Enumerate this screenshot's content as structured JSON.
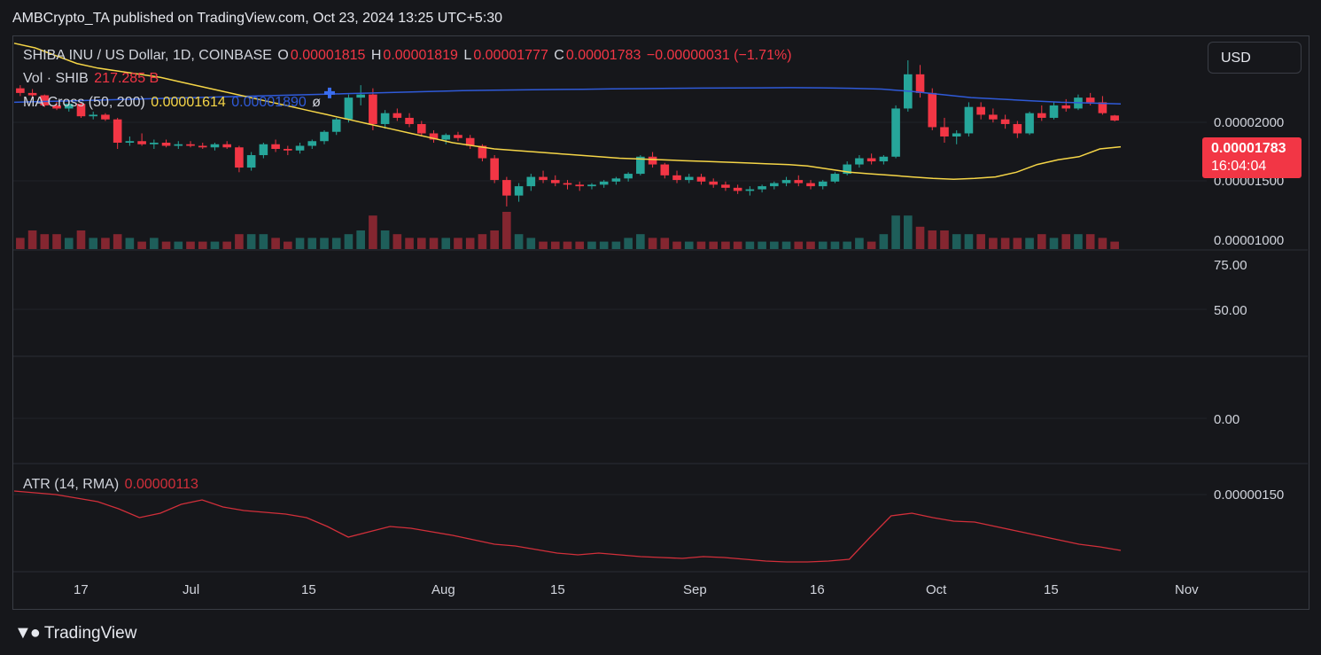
{
  "header": {
    "published": "AMBCrypto_TA published on TradingView.com, Oct 23, 2024 13:25 UTC+5:30"
  },
  "legend": {
    "symbol": "SHIBA INU / US Dollar, 1D, COINBASE",
    "o_label": "O",
    "o_value": "0.00001815",
    "h_label": "H",
    "h_value": "0.00001819",
    "l_label": "L",
    "l_value": "0.00001777",
    "c_label": "C",
    "c_value": "0.00001783",
    "change": "−0.00000031 (−1.71%)",
    "vol_label": "Vol · SHIB",
    "vol_value": "217.285 B",
    "ma_label": "MA Cross (50, 200)",
    "ma50_value": "0.00001614",
    "ma200_value": "0.00001890",
    "ma_extra": "ø",
    "atr_label": "ATR (14, RMA)",
    "atr_value": "0.00000113"
  },
  "toolbar": {
    "currency": "USD"
  },
  "price_tag": {
    "value": "0.00001783",
    "countdown": "16:04:04"
  },
  "y_axis": {
    "price_ticks": [
      "0.00002000",
      "0.00001500",
      "0.00001000"
    ],
    "osc_ticks": [
      "75.00",
      "50.00",
      "0.00"
    ],
    "atr_ticks": [
      "0.00000150"
    ]
  },
  "x_axis": {
    "ticks": [
      "17",
      "Jul",
      "15",
      "Aug",
      "15",
      "Sep",
      "16",
      "Oct",
      "15",
      "Nov"
    ]
  },
  "brand": {
    "name": "TradingView"
  },
  "colors": {
    "up": "#26a69a",
    "down": "#f23645",
    "ma50": "#f5d547",
    "ma200": "#2f5ad8",
    "atr": "#d12f3a",
    "bg": "#16171b"
  },
  "chart_data": {
    "type": "candlestick",
    "title": "SHIBA INU / US Dollar, 1D, COINBASE",
    "ylim": [
      9.5e-06,
      2.33e-05
    ],
    "candles": [
      [
        1.99e-05,
        2.01e-05,
        1.94e-05,
        1.96e-05
      ],
      [
        1.96e-05,
        1.985e-05,
        1.925e-05,
        1.945e-05
      ],
      [
        1.945e-05,
        1.95e-05,
        1.87e-05,
        1.88e-05
      ],
      [
        1.88e-05,
        1.91e-05,
        1.85e-05,
        1.86e-05
      ],
      [
        1.86e-05,
        1.9e-05,
        1.84e-05,
        1.89e-05
      ],
      [
        1.89e-05,
        1.9e-05,
        1.8e-05,
        1.81e-05
      ],
      [
        1.81e-05,
        1.84e-05,
        1.79e-05,
        1.82e-05
      ],
      [
        1.82e-05,
        1.83e-05,
        1.78e-05,
        1.79e-05
      ],
      [
        1.79e-05,
        1.8e-05,
        1.6e-05,
        1.64e-05
      ],
      [
        1.64e-05,
        1.68e-05,
        1.62e-05,
        1.65e-05
      ],
      [
        1.65e-05,
        1.7e-05,
        1.62e-05,
        1.63e-05
      ],
      [
        1.63e-05,
        1.66e-05,
        1.6e-05,
        1.64e-05
      ],
      [
        1.64e-05,
        1.66e-05,
        1.61e-05,
        1.62e-05
      ],
      [
        1.62e-05,
        1.65e-05,
        1.6e-05,
        1.63e-05
      ],
      [
        1.63e-05,
        1.65e-05,
        1.61e-05,
        1.62e-05
      ],
      [
        1.62e-05,
        1.64e-05,
        1.6e-05,
        1.61e-05
      ],
      [
        1.61e-05,
        1.64e-05,
        1.59e-05,
        1.63e-05
      ],
      [
        1.63e-05,
        1.65e-05,
        1.6e-05,
        1.61e-05
      ],
      [
        1.61e-05,
        1.62e-05,
        1.45e-05,
        1.48e-05
      ],
      [
        1.48e-05,
        1.58e-05,
        1.46e-05,
        1.56e-05
      ],
      [
        1.56e-05,
        1.64e-05,
        1.54e-05,
        1.63e-05
      ],
      [
        1.63e-05,
        1.66e-05,
        1.58e-05,
        1.6e-05
      ],
      [
        1.6e-05,
        1.62e-05,
        1.56e-05,
        1.59e-05
      ],
      [
        1.59e-05,
        1.64e-05,
        1.57e-05,
        1.62e-05
      ],
      [
        1.62e-05,
        1.66e-05,
        1.6e-05,
        1.65e-05
      ],
      [
        1.65e-05,
        1.72e-05,
        1.63e-05,
        1.71e-05
      ],
      [
        1.71e-05,
        1.8e-05,
        1.69e-05,
        1.79e-05
      ],
      [
        1.79e-05,
        1.95e-05,
        1.77e-05,
        1.93e-05
      ],
      [
        1.93e-05,
        2.01e-05,
        1.88e-05,
        1.95e-05
      ],
      [
        1.95e-05,
        1.99e-05,
        1.72e-05,
        1.76e-05
      ],
      [
        1.76e-05,
        1.85e-05,
        1.73e-05,
        1.83e-05
      ],
      [
        1.83e-05,
        1.86e-05,
        1.78e-05,
        1.8e-05
      ],
      [
        1.8e-05,
        1.83e-05,
        1.74e-05,
        1.76e-05
      ],
      [
        1.76e-05,
        1.78e-05,
        1.68e-05,
        1.7e-05
      ],
      [
        1.7e-05,
        1.72e-05,
        1.64e-05,
        1.66e-05
      ],
      [
        1.66e-05,
        1.7e-05,
        1.63e-05,
        1.69e-05
      ],
      [
        1.69e-05,
        1.71e-05,
        1.65e-05,
        1.67e-05
      ],
      [
        1.67e-05,
        1.69e-05,
        1.6e-05,
        1.62e-05
      ],
      [
        1.62e-05,
        1.63e-05,
        1.52e-05,
        1.54e-05
      ],
      [
        1.54e-05,
        1.56e-05,
        1.38e-05,
        1.4e-05
      ],
      [
        1.4e-05,
        1.42e-05,
        1.23e-05,
        1.3e-05
      ],
      [
        1.3e-05,
        1.38e-05,
        1.26e-05,
        1.36e-05
      ],
      [
        1.36e-05,
        1.44e-05,
        1.33e-05,
        1.42e-05
      ],
      [
        1.42e-05,
        1.46e-05,
        1.38e-05,
        1.4e-05
      ],
      [
        1.4e-05,
        1.43e-05,
        1.36e-05,
        1.38e-05
      ],
      [
        1.38e-05,
        1.4e-05,
        1.34e-05,
        1.37e-05
      ],
      [
        1.37e-05,
        1.39e-05,
        1.33e-05,
        1.36e-05
      ],
      [
        1.36e-05,
        1.38e-05,
        1.34e-05,
        1.37e-05
      ],
      [
        1.37e-05,
        1.4e-05,
        1.35e-05,
        1.39e-05
      ],
      [
        1.39e-05,
        1.42e-05,
        1.37e-05,
        1.41e-05
      ],
      [
        1.41e-05,
        1.45e-05,
        1.39e-05,
        1.44e-05
      ],
      [
        1.44e-05,
        1.56e-05,
        1.43e-05,
        1.55e-05
      ],
      [
        1.55e-05,
        1.58e-05,
        1.48e-05,
        1.5e-05
      ],
      [
        1.5e-05,
        1.51e-05,
        1.41e-05,
        1.43e-05
      ],
      [
        1.43e-05,
        1.46e-05,
        1.38e-05,
        1.4e-05
      ],
      [
        1.4e-05,
        1.44e-05,
        1.38e-05,
        1.42e-05
      ],
      [
        1.42e-05,
        1.44e-05,
        1.37e-05,
        1.39e-05
      ],
      [
        1.39e-05,
        1.41e-05,
        1.35e-05,
        1.37e-05
      ],
      [
        1.37e-05,
        1.39e-05,
        1.33e-05,
        1.35e-05
      ],
      [
        1.35e-05,
        1.37e-05,
        1.31e-05,
        1.33e-05
      ],
      [
        1.33e-05,
        1.36e-05,
        1.3e-05,
        1.34e-05
      ],
      [
        1.34e-05,
        1.37e-05,
        1.32e-05,
        1.36e-05
      ],
      [
        1.36e-05,
        1.39e-05,
        1.34e-05,
        1.38e-05
      ],
      [
        1.38e-05,
        1.42e-05,
        1.36e-05,
        1.4e-05
      ],
      [
        1.4e-05,
        1.43e-05,
        1.36e-05,
        1.38e-05
      ],
      [
        1.38e-05,
        1.4e-05,
        1.34e-05,
        1.36e-05
      ],
      [
        1.36e-05,
        1.4e-05,
        1.34e-05,
        1.39e-05
      ],
      [
        1.39e-05,
        1.45e-05,
        1.38e-05,
        1.44e-05
      ],
      [
        1.44e-05,
        1.52e-05,
        1.43e-05,
        1.5e-05
      ],
      [
        1.5e-05,
        1.56e-05,
        1.48e-05,
        1.54e-05
      ],
      [
        1.54e-05,
        1.57e-05,
        1.5e-05,
        1.52e-05
      ],
      [
        1.52e-05,
        1.56e-05,
        1.5e-05,
        1.55e-05
      ],
      [
        1.55e-05,
        1.88e-05,
        1.54e-05,
        1.86e-05
      ],
      [
        1.86e-05,
        2.17e-05,
        1.84e-05,
        2.08e-05
      ],
      [
        2.08e-05,
        2.14e-05,
        1.93e-05,
        1.96e-05
      ],
      [
        1.96e-05,
        1.99e-05,
        1.72e-05,
        1.74e-05
      ],
      [
        1.74e-05,
        1.8e-05,
        1.64e-05,
        1.68e-05
      ],
      [
        1.68e-05,
        1.72e-05,
        1.63e-05,
        1.7e-05
      ],
      [
        1.7e-05,
        1.9e-05,
        1.68e-05,
        1.87e-05
      ],
      [
        1.87e-05,
        1.9e-05,
        1.79e-05,
        1.82e-05
      ],
      [
        1.82e-05,
        1.86e-05,
        1.77e-05,
        1.79e-05
      ],
      [
        1.79e-05,
        1.82e-05,
        1.73e-05,
        1.76e-05
      ],
      [
        1.76e-05,
        1.78e-05,
        1.67e-05,
        1.7e-05
      ],
      [
        1.7e-05,
        1.84e-05,
        1.69e-05,
        1.83e-05
      ],
      [
        1.83e-05,
        1.88e-05,
        1.78e-05,
        1.8e-05
      ],
      [
        1.8e-05,
        1.9e-05,
        1.79e-05,
        1.88e-05
      ],
      [
        1.88e-05,
        1.92e-05,
        1.84e-05,
        1.86e-05
      ],
      [
        1.86e-05,
        1.95e-05,
        1.85e-05,
        1.93e-05
      ],
      [
        1.93e-05,
        1.96e-05,
        1.88e-05,
        1.9e-05
      ],
      [
        1.9e-05,
        1.94e-05,
        1.82e-05,
        1.83e-05
      ],
      [
        1.815e-05,
        1.819e-05,
        1.777e-05,
        1.783e-05
      ]
    ],
    "volume": [
      3,
      5,
      4,
      4,
      3,
      5,
      3,
      3,
      4,
      3,
      2,
      3,
      2,
      2,
      2,
      2,
      2,
      2,
      4,
      4,
      4,
      3,
      2,
      3,
      3,
      3,
      3,
      4,
      5,
      9,
      5,
      4,
      3,
      3,
      3,
      3,
      3,
      3,
      4,
      5,
      10,
      4,
      3,
      2,
      2,
      2,
      2,
      2,
      2,
      2,
      3,
      4,
      3,
      3,
      2,
      2,
      2,
      2,
      2,
      2,
      2,
      2,
      2,
      2,
      2,
      2,
      2,
      2,
      2,
      3,
      2,
      4,
      9,
      9,
      6,
      5,
      5,
      4,
      4,
      4,
      3,
      3,
      3,
      3,
      4,
      3,
      4,
      4,
      4,
      3,
      2
    ],
    "ma50": [
      2.28e-05,
      2.25e-05,
      2.2e-05,
      2.15e-05,
      2.12e-05,
      2.1e-05,
      2.08e-05,
      2.06e-05,
      2.03e-05,
      2e-05,
      1.97e-05,
      1.94e-05,
      1.91e-05,
      1.88e-05,
      1.85e-05,
      1.82e-05,
      1.79e-05,
      1.76e-05,
      1.73e-05,
      1.7e-05,
      1.67e-05,
      1.64e-05,
      1.62e-05,
      1.6e-05,
      1.59e-05,
      1.58e-05,
      1.57e-05,
      1.56e-05,
      1.55e-05,
      1.54e-05,
      1.535e-05,
      1.53e-05,
      1.525e-05,
      1.52e-05,
      1.515e-05,
      1.51e-05,
      1.505e-05,
      1.5e-05,
      1.49e-05,
      1.47e-05,
      1.45e-05,
      1.44e-05,
      1.43e-05,
      1.42e-05,
      1.41e-05,
      1.405e-05,
      1.41e-05,
      1.42e-05,
      1.45e-05,
      1.5e-05,
      1.53e-05,
      1.55e-05,
      1.6e-05,
      1.614e-05
    ],
    "ma200": [
      1.9e-05,
      1.905e-05,
      1.91e-05,
      1.915e-05,
      1.92e-05,
      1.925e-05,
      1.93e-05,
      1.935e-05,
      1.94e-05,
      1.945e-05,
      1.95e-05,
      1.955e-05,
      1.96e-05,
      1.965e-05,
      1.97e-05,
      1.975e-05,
      1.978e-05,
      1.98e-05,
      1.982e-05,
      1.984e-05,
      1.986e-05,
      1.988e-05,
      1.99e-05,
      1.991e-05,
      1.992e-05,
      1.993e-05,
      1.994e-05,
      1.993e-05,
      1.99e-05,
      1.985e-05,
      1.97e-05,
      1.95e-05,
      1.93e-05,
      1.92e-05,
      1.91e-05,
      1.9e-05,
      1.895e-05,
      1.89e-05
    ],
    "atr": [
      1.8e-06,
      1.78e-06,
      1.76e-06,
      1.72e-06,
      1.68e-06,
      1.6e-06,
      1.5e-06,
      1.55e-06,
      1.65e-06,
      1.7e-06,
      1.62e-06,
      1.58e-06,
      1.56e-06,
      1.54e-06,
      1.5e-06,
      1.4e-06,
      1.28e-06,
      1.34e-06,
      1.4e-06,
      1.38e-06,
      1.34e-06,
      1.3e-06,
      1.25e-06,
      1.2e-06,
      1.18e-06,
      1.14e-06,
      1.1e-06,
      1.08e-06,
      1.1e-06,
      1.08e-06,
      1.06e-06,
      1.05e-06,
      1.04e-06,
      1.06e-06,
      1.05e-06,
      1.03e-06,
      1.01e-06,
      1e-06,
      1e-06,
      1.01e-06,
      1.03e-06,
      1.28e-06,
      1.52e-06,
      1.55e-06,
      1.5e-06,
      1.46e-06,
      1.45e-06,
      1.4e-06,
      1.35e-06,
      1.3e-06,
      1.25e-06,
      1.2e-06,
      1.17e-06,
      1.13e-06
    ]
  }
}
